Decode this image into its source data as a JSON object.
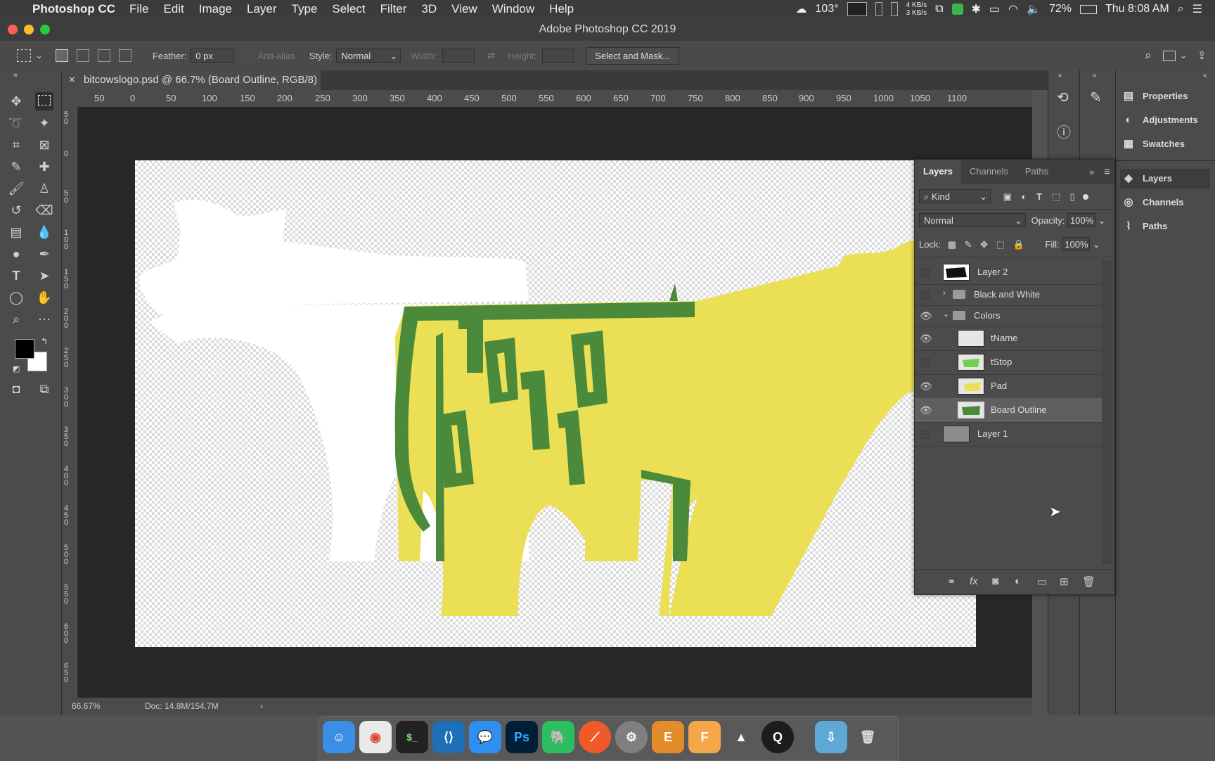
{
  "menubar": {
    "app_name": "Photoshop CC",
    "items": [
      "File",
      "Edit",
      "Image",
      "Layer",
      "Type",
      "Select",
      "Filter",
      "3D",
      "View",
      "Window",
      "Help"
    ],
    "temperature": "103°",
    "net_up": "4 KB/s",
    "net_down": "3 KB/s",
    "battery": "72%",
    "clock": "Thu 8:08 AM"
  },
  "window": {
    "title": "Adobe Photoshop CC 2019"
  },
  "options": {
    "feather_label": "Feather:",
    "feather_value": "0 px",
    "antialias_label": "Anti-alias",
    "style_label": "Style:",
    "style_value": "Normal",
    "width_label": "Width:",
    "height_label": "Height:",
    "select_mask_label": "Select and Mask..."
  },
  "document": {
    "tab_title": "bitcowslogo.psd @ 66.7% (Board Outline, RGB/8)"
  },
  "ruler": {
    "h_ticks": [
      "50",
      "0",
      "50",
      "100",
      "150",
      "200",
      "250",
      "300",
      "350",
      "400",
      "450",
      "500",
      "550",
      "600",
      "650",
      "700",
      "750",
      "800",
      "850",
      "900",
      "950",
      "1000",
      "1050",
      "1100"
    ],
    "v_ticks": [
      "50",
      "0",
      "50",
      "100",
      "150",
      "200",
      "250",
      "300",
      "350",
      "400",
      "450",
      "500",
      "550",
      "600",
      "650"
    ]
  },
  "status": {
    "zoom": "66.67%",
    "doc_size": "Doc: 14.8M/154.7M"
  },
  "right_panels": {
    "group1": [
      "Properties",
      "Adjustments",
      "Swatches"
    ],
    "group2": [
      "Layers",
      "Channels",
      "Paths"
    ]
  },
  "layers_panel": {
    "tabs": [
      "Layers",
      "Channels",
      "Paths"
    ],
    "filter_kind": "Kind",
    "blend_mode": "Normal",
    "opacity_label": "Opacity:",
    "opacity_value": "100%",
    "lock_label": "Lock:",
    "fill_label": "Fill:",
    "fill_value": "100%",
    "layers": [
      {
        "name": "Layer 2",
        "visible": false
      },
      {
        "name": "Black and White",
        "visible": false
      },
      {
        "name": "Colors",
        "visible": true
      },
      {
        "name": "tName",
        "visible": true
      },
      {
        "name": "tStop",
        "visible": false
      },
      {
        "name": "Pad",
        "visible": true
      },
      {
        "name": "Board Outline",
        "visible": true
      },
      {
        "name": "Layer 1",
        "visible": false
      }
    ]
  },
  "colors": {
    "cow_yellow": "#ebe055",
    "board_green": "#4a8a3a",
    "ui_panel": "#4b4b4b"
  }
}
